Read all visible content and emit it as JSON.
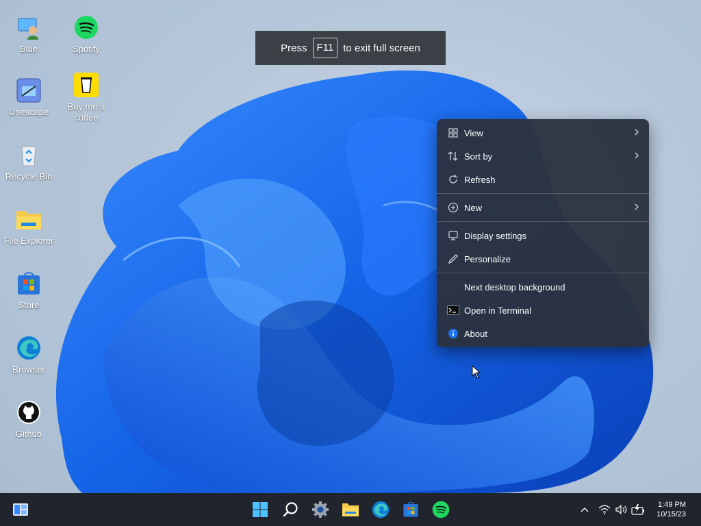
{
  "desktop": {
    "icons": [
      {
        "label": "Blue"
      },
      {
        "label": "Spotify"
      },
      {
        "label": "Unescape"
      },
      {
        "label": "Buy me a coffee"
      },
      {
        "label": "Recycle Bin"
      },
      {
        "label": "File Explorer"
      },
      {
        "label": "Store"
      },
      {
        "label": "Browser"
      },
      {
        "label": "Github"
      }
    ]
  },
  "fullscreen_banner": {
    "prefix": "Press",
    "key": "F11",
    "suffix": "to exit full screen"
  },
  "context_menu": {
    "items": [
      {
        "label": "View",
        "icon": "grid-view-icon"
      },
      {
        "label": "Sort by",
        "icon": "sort-icon"
      },
      {
        "label": "Refresh",
        "icon": "refresh-icon"
      },
      {
        "label": "New",
        "icon": "plus-circle-icon"
      },
      {
        "label": "Display settings",
        "icon": "display-icon"
      },
      {
        "label": "Personalize",
        "icon": "pen-icon"
      },
      {
        "label": "Next desktop background",
        "icon": ""
      },
      {
        "label": "Open in Terminal",
        "icon": "terminal-icon"
      },
      {
        "label": "About",
        "icon": "info-icon"
      }
    ]
  },
  "taskbar": {
    "clock": {
      "time": "1:49 PM",
      "date": "10/15/23"
    }
  },
  "colors": {
    "accent": "#1a73e8",
    "menu_bg": "#2c323e",
    "taskbar_bg": "#20242c"
  }
}
